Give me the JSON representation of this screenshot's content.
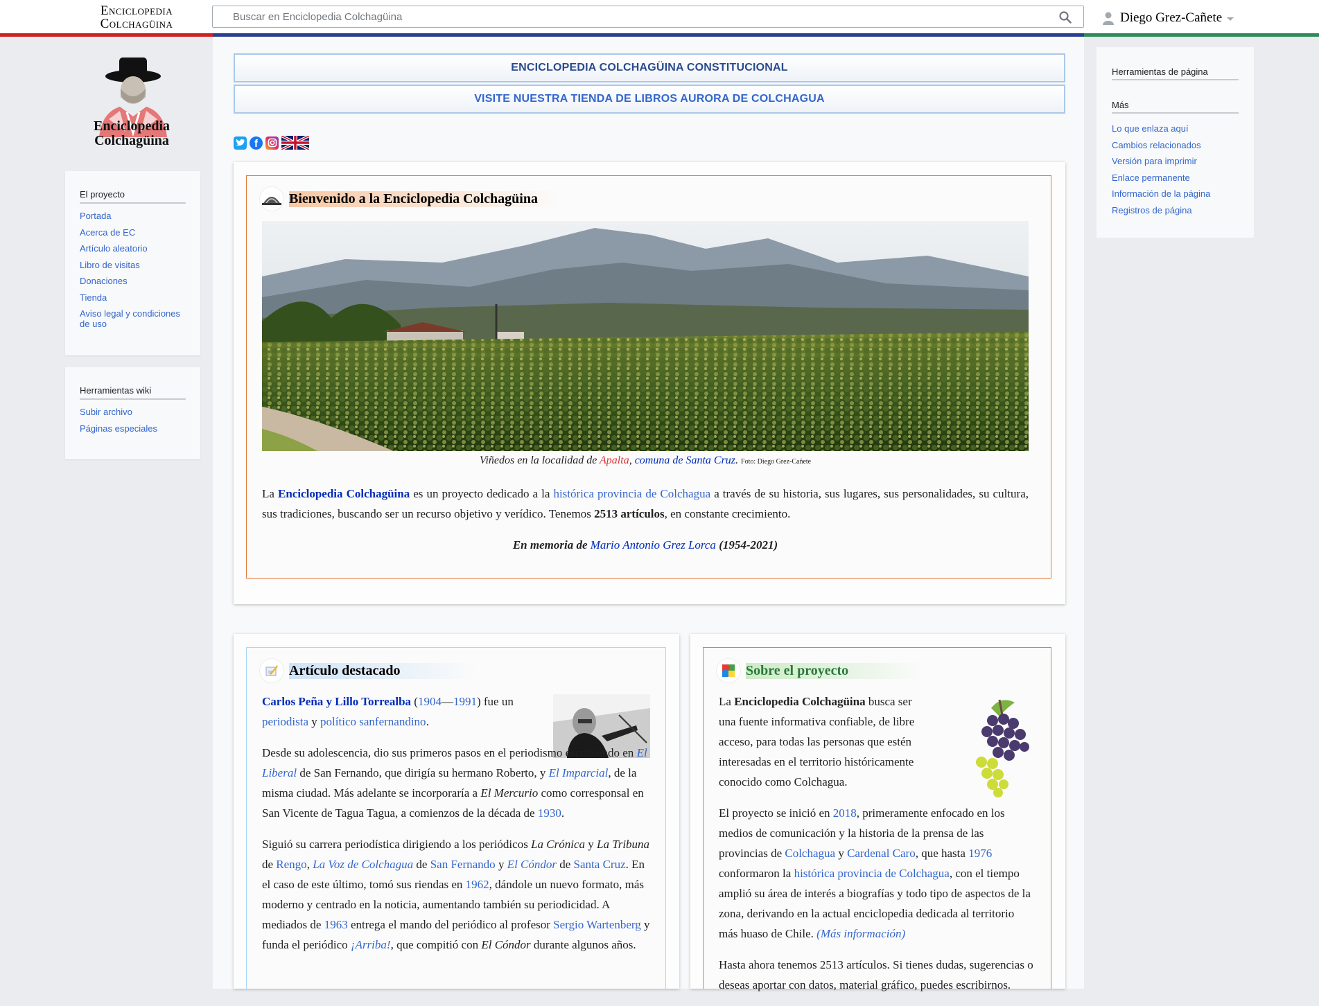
{
  "brand": {
    "wordmark_line1": "Enciclopedia",
    "wordmark_line2": "Colchagüina",
    "logo_line1": "Enciclopedia",
    "logo_line2": "Colchagüina"
  },
  "search": {
    "placeholder": "Buscar en Enciclopedia Colchagüina",
    "value": ""
  },
  "user": {
    "name": "Diego Grez-Cañete"
  },
  "colors": {
    "stripe": [
      "#cc2222",
      "#2a3f8f",
      "#2e8b57"
    ],
    "link": "#3366cc",
    "banner_text": "#2a4b8d",
    "welcome_border": "#e07b39",
    "featured_border": "#a7d7f9",
    "about_border": "#6fb551"
  },
  "sidebar": {
    "proyecto": {
      "heading": "El proyecto",
      "items": [
        "Portada",
        "Acerca de EC",
        "Artículo aleatorio",
        "Libro de visitas",
        "Donaciones",
        "Tienda",
        "Aviso legal y condiciones de uso"
      ]
    },
    "wiki": {
      "heading": "Herramientas wiki",
      "items": [
        "Subir archivo",
        "Páginas especiales"
      ]
    }
  },
  "banners": [
    {
      "label": "ENCICLOPEDIA COLCHAGÜINA CONSTITUCIONAL",
      "color": "#2a4b8d"
    },
    {
      "label": "VISITE NUESTRA TIENDA DE LIBROS AURORA DE COLCHAGUA",
      "color": "#3366cc"
    }
  ],
  "social": [
    "twitter-icon",
    "facebook-icon",
    "instagram-icon",
    "uk-flag-icon"
  ],
  "welcome": {
    "title": "Bienvenido a la Enciclopedia Colchagüina",
    "caption": {
      "prefix": "Viñedos en la localidad de ",
      "link1": "Apalta",
      "sep": ", ",
      "link2": "comuna de Santa Cruz",
      "end": ". ",
      "credit": "Foto: Diego Grez-Cañete"
    },
    "intro": {
      "t1": "La ",
      "name": "Enciclopedia Colchagüina",
      "t2": " es un proyecto dedicado a la ",
      "link": "histórica provincia de Colchagua",
      "t3": " a través de su historia, sus lugares, sus personalidades, su cul­tura, sus tradiciones, buscando ser un recurso objetivo y verídico. Tenemos ",
      "count": "2513 artículos",
      "t4": ", en constante crecimiento."
    },
    "memoriam": {
      "prefix": "En memoria de ",
      "link": "Mario Antonio Grez Lorca",
      "suffix": " (1954-2021)"
    }
  },
  "featured": {
    "title": "Artículo destacado",
    "p1": {
      "name": "Carlos Peña y Lillo Torrealba",
      "open": " (",
      "y1": "1904",
      "dash": "—",
      "y2": "1991",
      "t1": ") fue un ",
      "l1": "periodista",
      "t2": " y ",
      "l2": "político",
      "t3": " ",
      "l3": "sanfernandino",
      "t4": "."
    },
    "p2": {
      "t1": "Desde su adolescencia, dio sus primeros pasos en el periodismo escribiendo en ",
      "l1": "El Liberal",
      "t2": " de San Fernando, que dirigía su hermano Roberto, y ",
      "l2": "El Imparcial",
      "t3": ", de la misma ciudad. Más adelante se incorporaría a ",
      "i1": "El Mercurio",
      "t4": " como corresponsal en San Vicente de Tagua Tagua, a comienzos de la década de ",
      "l3": "1930",
      "t5": "."
    },
    "p3": {
      "t1": "Siguió su carrera periodística dirigiendo a los periódicos ",
      "i1": "La Crónica",
      "t2": " y ",
      "i2": "La Tribuna",
      "t3": " de ",
      "l1": "Rengo",
      "t4": ", ",
      "l2": "La Voz de Colchagua",
      "t5": " de ",
      "l3": "San Fernando",
      "t6": " y ",
      "l4": "El Cóndor",
      "t7": " de ",
      "l5": "Santa Cruz",
      "t8": ". En el caso de este último, tomó sus riendas en ",
      "l6": "1962",
      "t9": ", dándole un nuevo formato, más moderno y centrado en la noticia, aumentando también su periodicidad. A mediados de ",
      "l7": "1963",
      "t10": " entrega el mando del periódico al profesor ",
      "l8": "Sergio Wartenberg",
      "t11": " y funda el periódico ",
      "l9": "¡Arriba!",
      "t12": ", que compitió con ",
      "i3": "El Cóndor",
      "t13": " durante algunos años."
    }
  },
  "about": {
    "title": "Sobre el proyecto",
    "p1": {
      "t1": "La ",
      "b1": "Enciclopedia Colchagüina",
      "t2": " busca ser una fuente informativa confiable, de libre acceso, para todas las personas que estén interesadas en el territorio históricamente conocido como Colchagua."
    },
    "p2": {
      "t1": "El proyecto se inició en ",
      "l1": "2018",
      "t2": ", primeramen­te enfocado en los medios de comunicación y la historia de la prensa de las provincias de ",
      "l2": "Colchagua",
      "t3": " y ",
      "l3": "Cardenal Caro",
      "t4": ", que hasta ",
      "l4": "1976",
      "t5": " conformaron la ",
      "l5": "histórica provincia de Colchagua",
      "t6": ", con el tiempo amplió su área de interés a biografías y todo tipo de aspectos de la zona, derivando en la actual enciclopedia dedi­cada al territorio más huaso de Chile. ",
      "l6": "(Más información)"
    },
    "p3": {
      "t1": "Hasta ahora tenemos 2513 artículos. Si tienes dudas, sugerencias o deseas aportar con datos, material gráfico, puedes escribirnos."
    }
  },
  "tools": {
    "heading": "Herramientas de página",
    "more_heading": "Más",
    "items": [
      "Lo que enlaza aquí",
      "Cambios relacionados",
      "Versión para imprimir",
      "Enlace permanente",
      "Información de la página",
      "Registros de página"
    ]
  }
}
